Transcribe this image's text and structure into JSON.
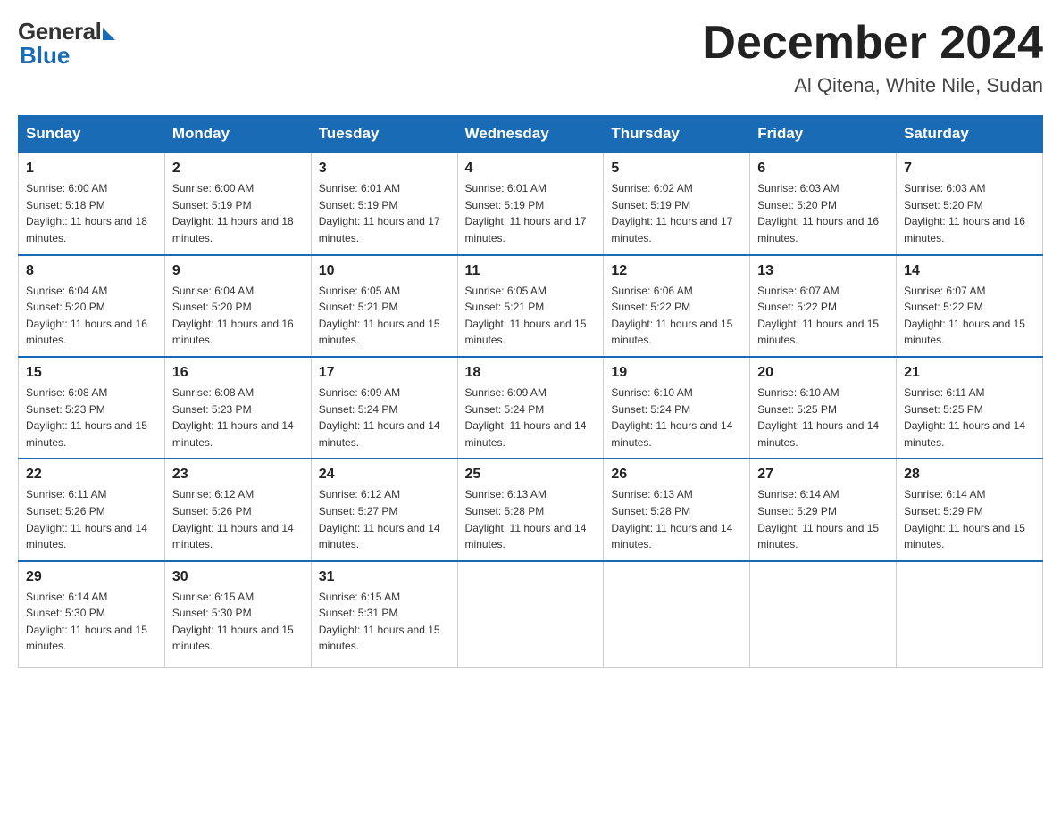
{
  "logo": {
    "general": "General",
    "blue": "Blue"
  },
  "title": "December 2024",
  "location": "Al Qitena, White Nile, Sudan",
  "days_of_week": [
    "Sunday",
    "Monday",
    "Tuesday",
    "Wednesday",
    "Thursday",
    "Friday",
    "Saturday"
  ],
  "weeks": [
    [
      {
        "day": "1",
        "sunrise": "6:00 AM",
        "sunset": "5:18 PM",
        "daylight": "11 hours and 18 minutes."
      },
      {
        "day": "2",
        "sunrise": "6:00 AM",
        "sunset": "5:19 PM",
        "daylight": "11 hours and 18 minutes."
      },
      {
        "day": "3",
        "sunrise": "6:01 AM",
        "sunset": "5:19 PM",
        "daylight": "11 hours and 17 minutes."
      },
      {
        "day": "4",
        "sunrise": "6:01 AM",
        "sunset": "5:19 PM",
        "daylight": "11 hours and 17 minutes."
      },
      {
        "day": "5",
        "sunrise": "6:02 AM",
        "sunset": "5:19 PM",
        "daylight": "11 hours and 17 minutes."
      },
      {
        "day": "6",
        "sunrise": "6:03 AM",
        "sunset": "5:20 PM",
        "daylight": "11 hours and 16 minutes."
      },
      {
        "day": "7",
        "sunrise": "6:03 AM",
        "sunset": "5:20 PM",
        "daylight": "11 hours and 16 minutes."
      }
    ],
    [
      {
        "day": "8",
        "sunrise": "6:04 AM",
        "sunset": "5:20 PM",
        "daylight": "11 hours and 16 minutes."
      },
      {
        "day": "9",
        "sunrise": "6:04 AM",
        "sunset": "5:20 PM",
        "daylight": "11 hours and 16 minutes."
      },
      {
        "day": "10",
        "sunrise": "6:05 AM",
        "sunset": "5:21 PM",
        "daylight": "11 hours and 15 minutes."
      },
      {
        "day": "11",
        "sunrise": "6:05 AM",
        "sunset": "5:21 PM",
        "daylight": "11 hours and 15 minutes."
      },
      {
        "day": "12",
        "sunrise": "6:06 AM",
        "sunset": "5:22 PM",
        "daylight": "11 hours and 15 minutes."
      },
      {
        "day": "13",
        "sunrise": "6:07 AM",
        "sunset": "5:22 PM",
        "daylight": "11 hours and 15 minutes."
      },
      {
        "day": "14",
        "sunrise": "6:07 AM",
        "sunset": "5:22 PM",
        "daylight": "11 hours and 15 minutes."
      }
    ],
    [
      {
        "day": "15",
        "sunrise": "6:08 AM",
        "sunset": "5:23 PM",
        "daylight": "11 hours and 15 minutes."
      },
      {
        "day": "16",
        "sunrise": "6:08 AM",
        "sunset": "5:23 PM",
        "daylight": "11 hours and 14 minutes."
      },
      {
        "day": "17",
        "sunrise": "6:09 AM",
        "sunset": "5:24 PM",
        "daylight": "11 hours and 14 minutes."
      },
      {
        "day": "18",
        "sunrise": "6:09 AM",
        "sunset": "5:24 PM",
        "daylight": "11 hours and 14 minutes."
      },
      {
        "day": "19",
        "sunrise": "6:10 AM",
        "sunset": "5:24 PM",
        "daylight": "11 hours and 14 minutes."
      },
      {
        "day": "20",
        "sunrise": "6:10 AM",
        "sunset": "5:25 PM",
        "daylight": "11 hours and 14 minutes."
      },
      {
        "day": "21",
        "sunrise": "6:11 AM",
        "sunset": "5:25 PM",
        "daylight": "11 hours and 14 minutes."
      }
    ],
    [
      {
        "day": "22",
        "sunrise": "6:11 AM",
        "sunset": "5:26 PM",
        "daylight": "11 hours and 14 minutes."
      },
      {
        "day": "23",
        "sunrise": "6:12 AM",
        "sunset": "5:26 PM",
        "daylight": "11 hours and 14 minutes."
      },
      {
        "day": "24",
        "sunrise": "6:12 AM",
        "sunset": "5:27 PM",
        "daylight": "11 hours and 14 minutes."
      },
      {
        "day": "25",
        "sunrise": "6:13 AM",
        "sunset": "5:28 PM",
        "daylight": "11 hours and 14 minutes."
      },
      {
        "day": "26",
        "sunrise": "6:13 AM",
        "sunset": "5:28 PM",
        "daylight": "11 hours and 14 minutes."
      },
      {
        "day": "27",
        "sunrise": "6:14 AM",
        "sunset": "5:29 PM",
        "daylight": "11 hours and 15 minutes."
      },
      {
        "day": "28",
        "sunrise": "6:14 AM",
        "sunset": "5:29 PM",
        "daylight": "11 hours and 15 minutes."
      }
    ],
    [
      {
        "day": "29",
        "sunrise": "6:14 AM",
        "sunset": "5:30 PM",
        "daylight": "11 hours and 15 minutes."
      },
      {
        "day": "30",
        "sunrise": "6:15 AM",
        "sunset": "5:30 PM",
        "daylight": "11 hours and 15 minutes."
      },
      {
        "day": "31",
        "sunrise": "6:15 AM",
        "sunset": "5:31 PM",
        "daylight": "11 hours and 15 minutes."
      },
      null,
      null,
      null,
      null
    ]
  ]
}
